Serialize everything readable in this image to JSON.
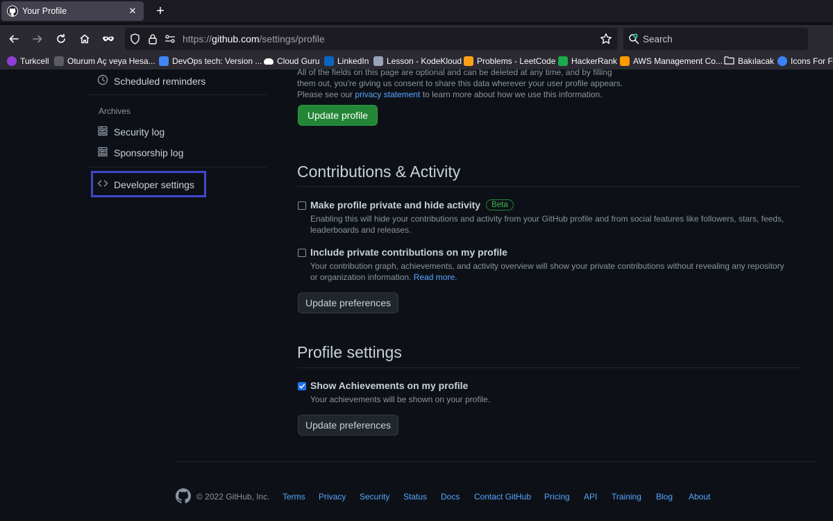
{
  "browser": {
    "tab_title": "Your Profile",
    "tab_close": "✕",
    "new_tab": "+",
    "url_prefix": "https://",
    "url_host": "github.com",
    "url_path": "/settings/profile",
    "search_placeholder": "Search",
    "bookmarks": [
      {
        "label": "Turkcell",
        "color": "#8e3ed6"
      },
      {
        "label": "Oturum Aç veya Hesa...",
        "color": "#5b5b66"
      },
      {
        "label": "DevOps tech: Version ...",
        "color": "#4285f4"
      },
      {
        "label": "Cloud Guru",
        "color": "#ffffff"
      },
      {
        "label": "LinkedIn",
        "color": "#0a66c2"
      },
      {
        "label": "Lesson - KodeKloud",
        "color": "#9aa4b8"
      },
      {
        "label": "Problems - LeetCode",
        "color": "#ffa116"
      },
      {
        "label": "HackerRank",
        "color": "#1ba94c"
      },
      {
        "label": "AWS Management Co...",
        "color": "#ff9900"
      },
      {
        "label": "Bakılacak",
        "color": "#fbfbfe"
      },
      {
        "label": "Icons For Fre",
        "color": "#3b82f6"
      }
    ]
  },
  "sidebar": {
    "scheduled_reminders": "Scheduled reminders",
    "archives_heading": "Archives",
    "security_log": "Security log",
    "sponsorship_log": "Sponsorship log",
    "developer_settings": "Developer settings"
  },
  "main": {
    "intro_text": "All of the fields on this page are optional and can be deleted at any time, and by filling them out, you're giving us consent to share this data wherever your user profile appears. Please see our",
    "privacy_link": "privacy statement",
    "intro_suffix": "to learn more about how we use this information.",
    "update_profile_button": "Update profile",
    "contributions": {
      "title": "Contributions & Activity",
      "private_label": "Make profile private and hide activity",
      "beta_badge": "Beta",
      "private_note": "Enabling this will hide your contributions and activity from your GitHub profile and from social features like followers, stars, feeds, leaderboards and releases.",
      "private_checked": false,
      "include_label": "Include private contributions on my profile",
      "include_note": "Your contribution graph, achievements, and activity overview will show your private contributions without revealing any repository or organization information.",
      "read_more": "Read more.",
      "include_checked": false,
      "button": "Update preferences"
    },
    "profile_settings": {
      "title": "Profile settings",
      "achievements_label": "Show Achievements on my profile",
      "achievements_note": "Your achievements will be shown on your profile.",
      "achievements_checked": true,
      "button": "Update preferences"
    }
  },
  "footer": {
    "copyright": "© 2022 GitHub, Inc.",
    "links": [
      "Terms",
      "Privacy",
      "Security",
      "Status",
      "Docs",
      "Contact GitHub",
      "Pricing",
      "API",
      "Training",
      "Blog",
      "About"
    ]
  }
}
